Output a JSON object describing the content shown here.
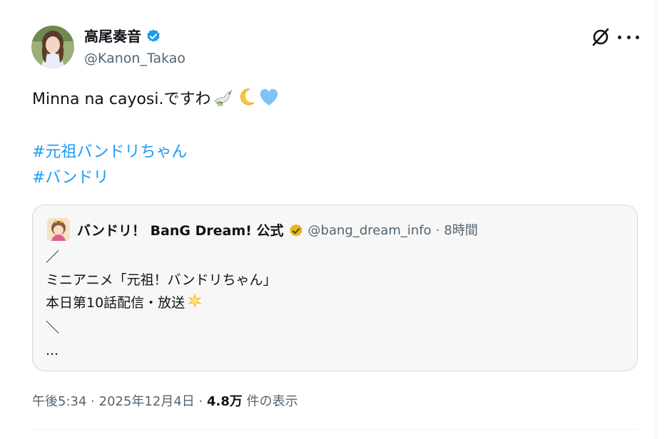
{
  "author": {
    "name": "高尾奏音",
    "handle": "@Kanon_Takao",
    "avatar_icon": "profile-photo",
    "verified_color": "#1d9bf0"
  },
  "tweet": {
    "text": "Minna na cayosi.ですわ",
    "emojis": [
      "dove-icon",
      "crescent-moon-icon",
      "light-blue-heart-icon"
    ],
    "hashtags": [
      "#元祖バンドリちゃん",
      "#バンドリ"
    ]
  },
  "quote": {
    "name": "バンドリ！ BanG Dream! 公式",
    "handle": "@bang_dream_info",
    "separator": "·",
    "time": "8時間",
    "verified_color": "#e2b719",
    "lines": [
      "／",
      "ミニアニメ「元祖！バンドリちゃん」",
      "本日第10話配信・放送",
      "＼",
      "..."
    ]
  },
  "meta": {
    "time": "午後5:34",
    "dot1": "·",
    "date": "2025年12月4日",
    "dot2": "·",
    "views": "4.8万",
    "views_label": "件の表示"
  },
  "colors": {
    "link": "#1d9bf0",
    "secondary_text": "#536471",
    "card_bg": "#f7f7f7",
    "card_border": "#cfd9de"
  }
}
